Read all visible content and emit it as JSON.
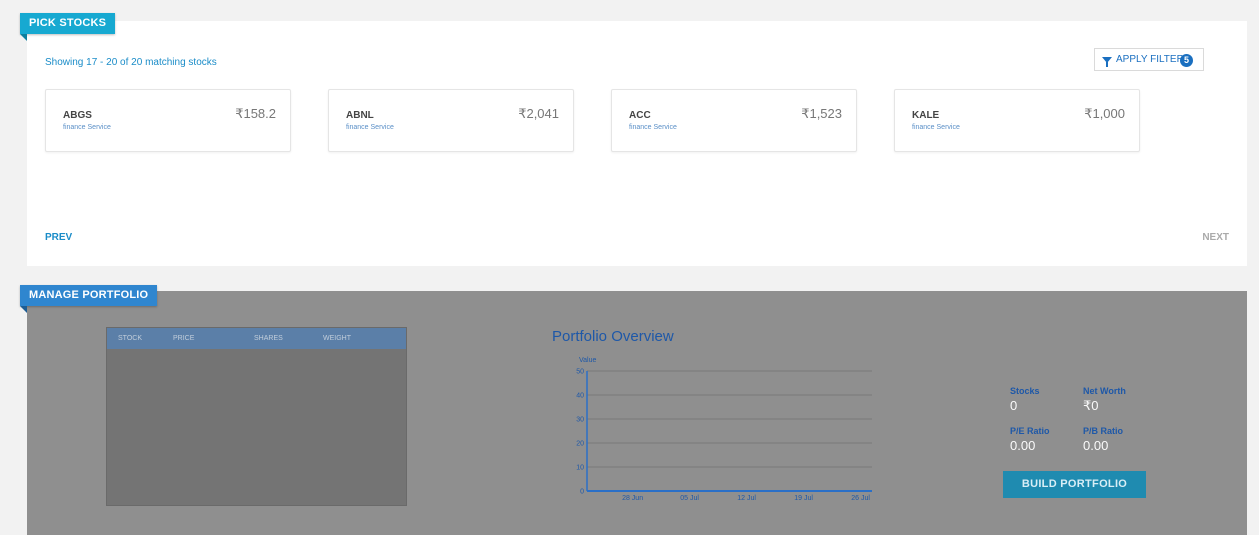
{
  "pick": {
    "ribbon": "PICK STOCKS",
    "showing": "Showing 17 - 20 of 20 matching stocks",
    "filter_label": "APPLY FILTER",
    "filter_count": "5",
    "stocks": [
      {
        "symbol": "ABGS",
        "sector": "finance Service",
        "price": "₹158.2"
      },
      {
        "symbol": "ABNL",
        "sector": "finance Service",
        "price": "₹2,041"
      },
      {
        "symbol": "ACC",
        "sector": "finance Service",
        "price": "₹1,523"
      },
      {
        "symbol": "KALE",
        "sector": "finance Service",
        "price": "₹1,000"
      }
    ],
    "prev": "PREV",
    "next": "NEXT"
  },
  "manage": {
    "ribbon": "MANAGE PORTFOLIO",
    "table_headers": [
      "STOCK",
      "PRICE",
      "SHARES",
      "WEIGHT"
    ],
    "chart_title": "Portfolio Overview",
    "stats": {
      "stocks_label": "Stocks",
      "stocks_value": "0",
      "networth_label": "Net Worth",
      "networth_value": "₹0",
      "pe_label": "P/E Ratio",
      "pe_value": "0.00",
      "pb_label": "P/B Ratio",
      "pb_value": "0.00"
    },
    "build_label": "BUILD PORTFOLIO"
  },
  "colors": {
    "accent_blue": "#1a8cc8",
    "ribbon_pick": "#17a9d1",
    "ribbon_manage": "#2f86cf",
    "chart_title": "#1e58a8",
    "build_button": "#1f8bb0"
  },
  "chart_data": {
    "type": "line",
    "title": "Portfolio Overview",
    "ylabel": "Value",
    "xlabel": "",
    "ylim": [
      0,
      50
    ],
    "yticks": [
      0,
      10,
      20,
      30,
      40,
      50
    ],
    "categories": [
      "28 Jun",
      "05 Jul",
      "12 Jul",
      "19 Jul",
      "26 Jul"
    ],
    "series": [],
    "grid": true
  }
}
